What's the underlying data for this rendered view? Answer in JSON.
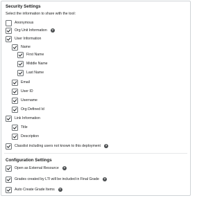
{
  "security": {
    "heading": "Security Settings",
    "instruction": "Select the information to share with the tool:",
    "anonymous": "Anonymous",
    "org_unit_info": "Org Unit Information",
    "user_info": "User Information",
    "name": "Name",
    "first_name": "First Name",
    "middle_name": "Middle Name",
    "last_name": "Last Name",
    "email": "Email",
    "user_id": "User ID",
    "username": "Username",
    "org_defined_id": "Org Defined Id",
    "link_info": "Link Information",
    "title": "Title",
    "description": "Description",
    "classlist": "Classlist including users not known to this deployment"
  },
  "configuration": {
    "heading": "Configuration Settings",
    "open_external": "Open as External Resource",
    "grades_final": "Grades created by LTI will be included in Final Grade",
    "auto_create": "Auto Create Grade Items"
  },
  "help_glyph": "?",
  "checked": {
    "anonymous": false,
    "org_unit_info": true,
    "user_info": true,
    "name": true,
    "first_name": true,
    "middle_name": true,
    "last_name": true,
    "email": true,
    "user_id": true,
    "username": true,
    "org_defined_id": true,
    "link_info": true,
    "title": true,
    "description": true,
    "classlist": true,
    "open_external": true,
    "grades_final": true,
    "auto_create": true
  },
  "icons": {
    "checkbox_checked": "check-icon",
    "help": "help-circle-icon"
  },
  "colors": {
    "checkmark": "#2a2d2f",
    "checkbox_border": "#6e7376",
    "help_bg": "#494c4e"
  }
}
